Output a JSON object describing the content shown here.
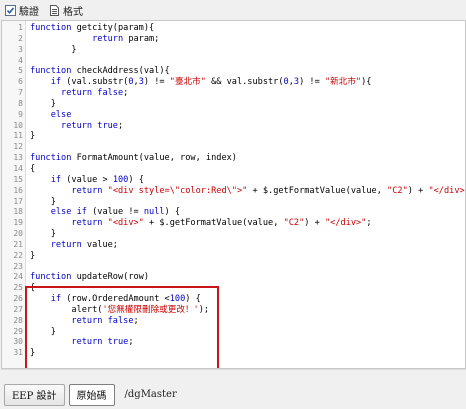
{
  "toolbar": {
    "validate_label": "驗證",
    "format_label": "格式"
  },
  "bottom": {
    "tab_design": "EEP 設計",
    "tab_source": "原始碼",
    "path": "/dgMaster"
  },
  "code": [
    {
      "n": "1",
      "t": [
        [
          "kw",
          "function "
        ],
        [
          "",
          "getcity(param){"
        ]
      ]
    },
    {
      "n": "2",
      "t": [
        [
          "",
          "            "
        ],
        [
          "kw",
          "return"
        ],
        [
          "",
          " param;"
        ]
      ]
    },
    {
      "n": "3",
      "t": [
        [
          "",
          "        }"
        ]
      ]
    },
    {
      "n": "4",
      "t": []
    },
    {
      "n": "5",
      "t": [
        [
          "kw",
          "function "
        ],
        [
          "",
          "checkAddress(val){"
        ]
      ]
    },
    {
      "n": "6",
      "t": [
        [
          "",
          "    "
        ],
        [
          "kw",
          "if"
        ],
        [
          "",
          " (val.substr("
        ],
        [
          "num",
          "0"
        ],
        [
          "",
          ","
        ],
        [
          "num",
          "3"
        ],
        [
          "",
          ") != "
        ],
        [
          "str",
          "\"臺北市\""
        ],
        [
          "",
          " && val.substr("
        ],
        [
          "num",
          "0"
        ],
        [
          "",
          ","
        ],
        [
          "num",
          "3"
        ],
        [
          "",
          ") != "
        ],
        [
          "str",
          "\"新北市\""
        ],
        [
          "",
          "){"
        ]
      ]
    },
    {
      "n": "7",
      "t": [
        [
          "",
          "      "
        ],
        [
          "kw",
          "return false"
        ],
        [
          "",
          ";"
        ]
      ]
    },
    {
      "n": "8",
      "t": [
        [
          "",
          "    }"
        ]
      ]
    },
    {
      "n": "9",
      "t": [
        [
          "",
          "    "
        ],
        [
          "kw",
          "else"
        ]
      ]
    },
    {
      "n": "10",
      "t": [
        [
          "",
          "      "
        ],
        [
          "kw",
          "return true"
        ],
        [
          "",
          ";"
        ]
      ]
    },
    {
      "n": "11",
      "t": [
        [
          "",
          "}"
        ]
      ]
    },
    {
      "n": "12",
      "t": []
    },
    {
      "n": "13",
      "t": [
        [
          "kw",
          "function "
        ],
        [
          "",
          "FormatAmount(value, row, index)"
        ]
      ]
    },
    {
      "n": "14",
      "t": [
        [
          "",
          "{"
        ]
      ]
    },
    {
      "n": "15",
      "t": [
        [
          "",
          "    "
        ],
        [
          "kw",
          "if"
        ],
        [
          "",
          " (value > "
        ],
        [
          "num",
          "100"
        ],
        [
          "",
          ") {"
        ]
      ]
    },
    {
      "n": "16",
      "t": [
        [
          "",
          "        "
        ],
        [
          "kw",
          "return"
        ],
        [
          "",
          " "
        ],
        [
          "str",
          "\"<div style=\\\"color:Red\\\">\""
        ],
        [
          "",
          " + $.getFormatValue(value, "
        ],
        [
          "str",
          "\"C2\""
        ],
        [
          "",
          ") + "
        ],
        [
          "str",
          "\"</div>\""
        ],
        [
          "",
          ";"
        ]
      ]
    },
    {
      "n": "17",
      "t": [
        [
          "",
          "    }"
        ]
      ]
    },
    {
      "n": "18",
      "t": [
        [
          "",
          "    "
        ],
        [
          "kw",
          "else if"
        ],
        [
          "",
          " (value != "
        ],
        [
          "kw",
          "null"
        ],
        [
          "",
          ") {"
        ]
      ]
    },
    {
      "n": "19",
      "t": [
        [
          "",
          "        "
        ],
        [
          "kw",
          "return"
        ],
        [
          "",
          " "
        ],
        [
          "str",
          "\"<div>\""
        ],
        [
          "",
          " + $.getFormatValue(value, "
        ],
        [
          "str",
          "\"C2\""
        ],
        [
          "",
          ") + "
        ],
        [
          "str",
          "\"</div>\""
        ],
        [
          "",
          ";"
        ]
      ]
    },
    {
      "n": "20",
      "t": [
        [
          "",
          "    }"
        ]
      ]
    },
    {
      "n": "21",
      "t": [
        [
          "",
          "    "
        ],
        [
          "kw",
          "return"
        ],
        [
          "",
          " value;"
        ]
      ]
    },
    {
      "n": "22",
      "t": [
        [
          "",
          "}"
        ]
      ]
    },
    {
      "n": "23",
      "t": []
    },
    {
      "n": "24",
      "t": [
        [
          "kw",
          "function "
        ],
        [
          "",
          "updateRow(row)"
        ]
      ]
    },
    {
      "n": "25",
      "t": [
        [
          "",
          "{"
        ]
      ]
    },
    {
      "n": "26",
      "t": [
        [
          "",
          "    "
        ],
        [
          "kw",
          "if"
        ],
        [
          "",
          " (row.OrderedAmount <"
        ],
        [
          "num",
          "100"
        ],
        [
          "",
          ") {"
        ]
      ]
    },
    {
      "n": "27",
      "t": [
        [
          "",
          "        alert("
        ],
        [
          "str",
          "'您無權限刪除或更改！'"
        ],
        [
          "",
          ");"
        ]
      ]
    },
    {
      "n": "28",
      "t": [
        [
          "",
          "        "
        ],
        [
          "kw",
          "return false"
        ],
        [
          "",
          ";"
        ]
      ]
    },
    {
      "n": "29",
      "t": [
        [
          "",
          "    }"
        ]
      ]
    },
    {
      "n": "30",
      "t": [
        [
          "",
          "        "
        ],
        [
          "kw",
          "return true"
        ],
        [
          "",
          ";"
        ]
      ]
    },
    {
      "n": "31",
      "t": [
        [
          "",
          "}"
        ]
      ]
    }
  ]
}
